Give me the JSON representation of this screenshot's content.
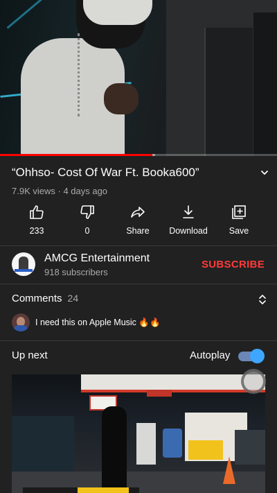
{
  "video": {
    "title": "“Ohhso- Cost Of War Ft. Booka600”",
    "views": "7.9K views",
    "age": "4 days ago",
    "meta_separator": " · ",
    "progress_fraction": 0.55,
    "buffered_fraction": 0.56
  },
  "actions": [
    {
      "label": "233",
      "icon": "thumb-up-icon"
    },
    {
      "label": "0",
      "icon": "thumb-down-icon"
    },
    {
      "label": "Share",
      "icon": "share-icon"
    },
    {
      "label": "Download",
      "icon": "download-icon"
    },
    {
      "label": "Save",
      "icon": "add-to-playlist-icon"
    }
  ],
  "channel": {
    "name": "AMCG Entertainment",
    "subscribers": "918 subscribers",
    "subscribe_label": "SUBSCRIBE"
  },
  "comments": {
    "heading": "Comments",
    "count": "24",
    "top_comment": "I need this on Apple Music 🔥🔥"
  },
  "up_next": {
    "heading": "Up next",
    "autoplay_label": "Autoplay",
    "autoplay_on": true
  },
  "colors": {
    "background": "#212121",
    "accent_red": "#ff3b3b",
    "toggle_blue": "#3ea6ff",
    "secondary_text": "#aaaaaa"
  }
}
